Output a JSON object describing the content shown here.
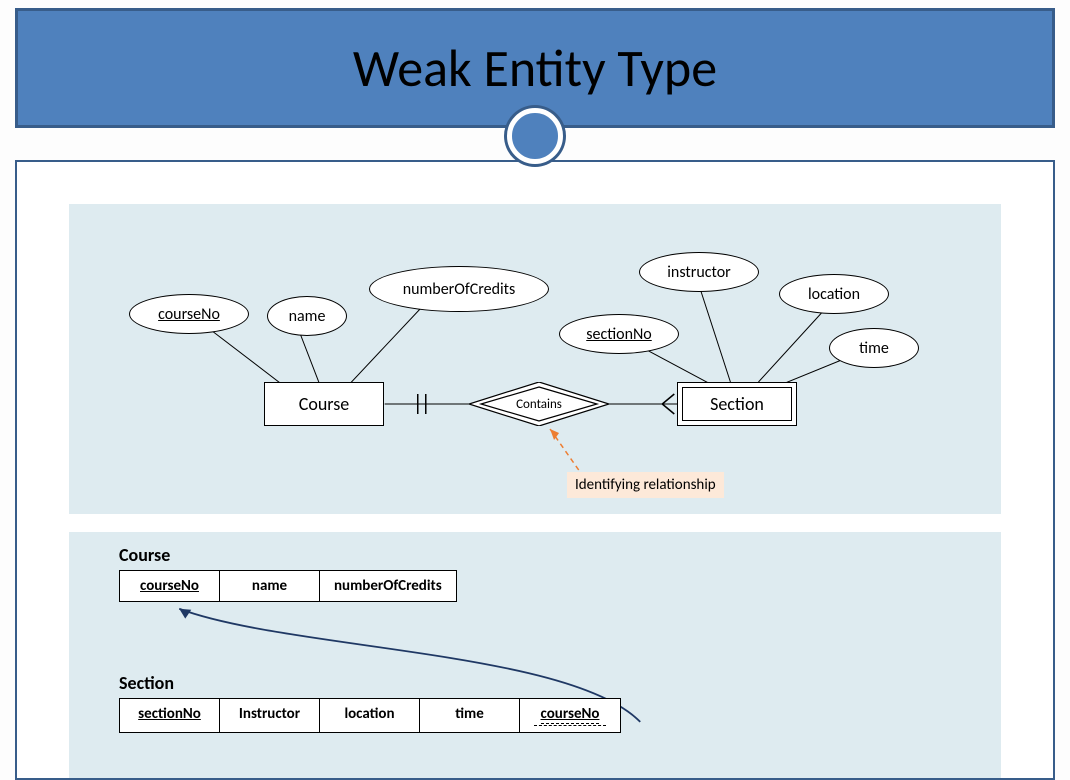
{
  "title": "Weak Entity Type",
  "er": {
    "attributes": {
      "courseNo": "courseNo",
      "name": "name",
      "numberOfCredits": "numberOfCredits",
      "sectionNo": "sectionNo",
      "instructor": "instructor",
      "location": "location",
      "time": "time"
    },
    "entities": {
      "course": "Course",
      "section": "Section"
    },
    "relationship": "Contains",
    "annotation": "Identifying relationship"
  },
  "schema": {
    "course": {
      "title": "Course",
      "cols": [
        "courseNo",
        "name",
        "numberOfCredits"
      ]
    },
    "section": {
      "title": "Section",
      "cols": [
        "sectionNo",
        "Instructor",
        "location",
        "time",
        "courseNo"
      ]
    }
  }
}
